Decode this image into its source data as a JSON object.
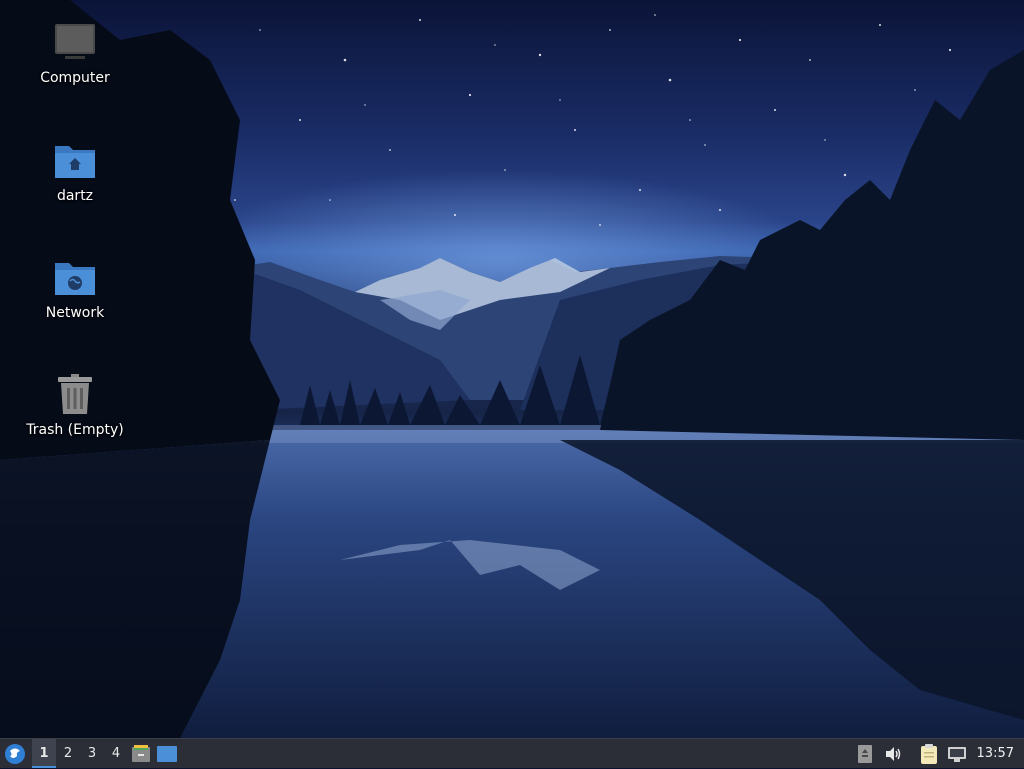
{
  "desktop": {
    "icons": [
      {
        "label": "Computer",
        "icon": "computer-icon"
      },
      {
        "label": "dartz",
        "icon": "home-folder-icon"
      },
      {
        "label": "Network",
        "icon": "network-folder-icon"
      },
      {
        "label": "Trash (Empty)",
        "icon": "trash-icon"
      }
    ]
  },
  "taskbar": {
    "start_icon": "start-menu-icon",
    "workspaces": [
      "1",
      "2",
      "3",
      "4"
    ],
    "active_workspace": "1",
    "launchers": [
      "file-manager-icon",
      "show-desktop-icon"
    ],
    "tray": [
      "usb-eject-icon",
      "volume-icon",
      "clipboard-icon",
      "network-icon"
    ],
    "clock": "13:57"
  },
  "colors": {
    "taskbar_bg": "#2b2e37",
    "accent": "#4a90d9",
    "folder_blue": "#4a8fd8"
  }
}
